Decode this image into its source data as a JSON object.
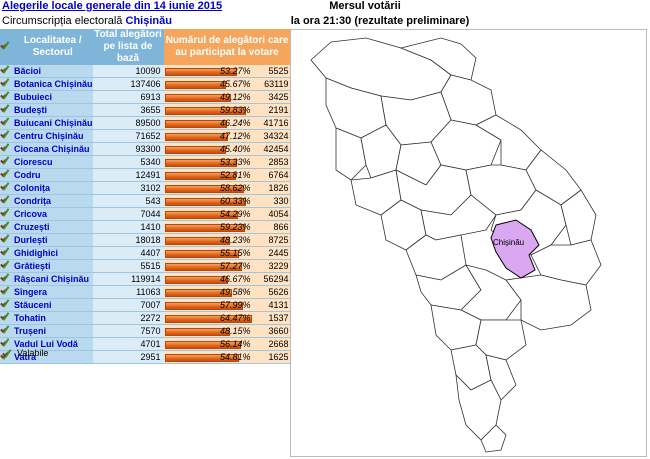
{
  "header": {
    "title": "Alegerile locale generale din 14 iunie 2015",
    "circ_label": "Circumscripția electorală",
    "circ_name": "Chișinău",
    "map_title": "Mersul votării",
    "time_label": "la ora 21:30 (rezultate preliminare)"
  },
  "table": {
    "col_locality": "Localitatea / Sectorul",
    "col_total": "Total alegători pe lista de bază",
    "col_voters": "Numărul de alegători care au participat la votare",
    "rows": [
      {
        "name": "Băcioi",
        "total": "10090",
        "pct": "53.27%",
        "voted": "5525",
        "frac": 0.5327
      },
      {
        "name": "Botanica Chișinău",
        "total": "137406",
        "pct": "45.67%",
        "voted": "63119",
        "frac": 0.4567
      },
      {
        "name": "Bubuieci",
        "total": "6913",
        "pct": "49.12%",
        "voted": "3425",
        "frac": 0.4912
      },
      {
        "name": "Budești",
        "total": "3655",
        "pct": "59.83%",
        "voted": "2191",
        "frac": 0.5983
      },
      {
        "name": "Buiucani Chișinău",
        "total": "89500",
        "pct": "46.24%",
        "voted": "41716",
        "frac": 0.4624
      },
      {
        "name": "Centru Chișinău",
        "total": "71652",
        "pct": "47.12%",
        "voted": "34324",
        "frac": 0.4712
      },
      {
        "name": "Ciocana Chișinău",
        "total": "93300",
        "pct": "45.40%",
        "voted": "42454",
        "frac": 0.454
      },
      {
        "name": "Ciorescu",
        "total": "5340",
        "pct": "53.33%",
        "voted": "2853",
        "frac": 0.5333
      },
      {
        "name": "Codru",
        "total": "12491",
        "pct": "52.81%",
        "voted": "6764",
        "frac": 0.5281
      },
      {
        "name": "Colonița",
        "total": "3102",
        "pct": "58.62%",
        "voted": "1826",
        "frac": 0.5862
      },
      {
        "name": "Condrița",
        "total": "543",
        "pct": "60.33%",
        "voted": "330",
        "frac": 0.6033
      },
      {
        "name": "Cricova",
        "total": "7044",
        "pct": "54.29%",
        "voted": "4054",
        "frac": 0.5429
      },
      {
        "name": "Cruzești",
        "total": "1410",
        "pct": "59.23%",
        "voted": "866",
        "frac": 0.5923
      },
      {
        "name": "Durlești",
        "total": "18018",
        "pct": "48.23%",
        "voted": "8725",
        "frac": 0.4823
      },
      {
        "name": "Ghidighici",
        "total": "4407",
        "pct": "55.15%",
        "voted": "2445",
        "frac": 0.5515
      },
      {
        "name": "Grătiești",
        "total": "5515",
        "pct": "57.27%",
        "voted": "3229",
        "frac": 0.5727
      },
      {
        "name": "Râșcani Chișinău",
        "total": "119914",
        "pct": "46.67%",
        "voted": "56294",
        "frac": 0.4667
      },
      {
        "name": "Sîngera",
        "total": "11063",
        "pct": "49.58%",
        "voted": "5626",
        "frac": 0.4958
      },
      {
        "name": "Stăuceni",
        "total": "7007",
        "pct": "57.99%",
        "voted": "4131",
        "frac": 0.5799
      },
      {
        "name": "Tohatin",
        "total": "2272",
        "pct": "64.47%",
        "voted": "1537",
        "frac": 0.6447
      },
      {
        "name": "Trușeni",
        "total": "7570",
        "pct": "48.15%",
        "voted": "3660",
        "frac": 0.4815
      },
      {
        "name": "Vadul Lui Vodă",
        "total": "4701",
        "pct": "56.14%",
        "voted": "2668",
        "frac": 0.5614
      },
      {
        "name": "Vatra",
        "total": "2951",
        "pct": "54.81%",
        "voted": "1625",
        "frac": 0.5481
      }
    ]
  },
  "legend": {
    "valid_label": "Valabile",
    "icon": "check-icon"
  },
  "map": {
    "highlight_label": "Chișinău",
    "highlight_color": "#d9a8f0",
    "border_color": "#000000"
  },
  "colors": {
    "header_blue": "#7fb5d9",
    "header_orange": "#f5a55c",
    "bar_orange": "#e06418",
    "link_blue": "#0000cc"
  }
}
